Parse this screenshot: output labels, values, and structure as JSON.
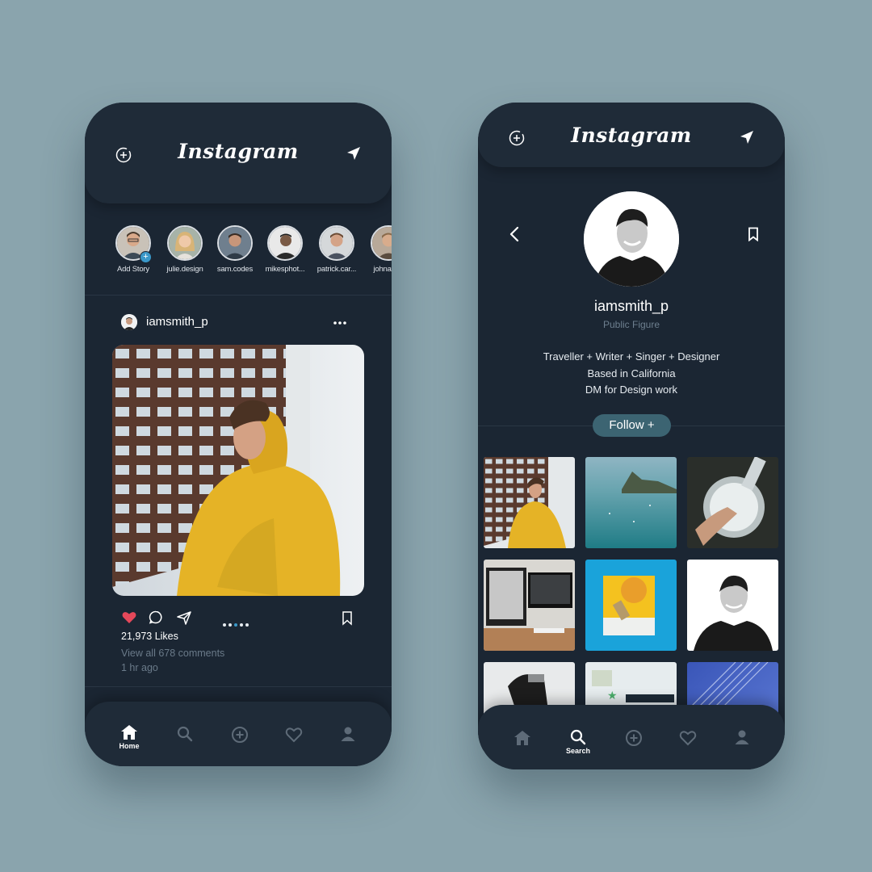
{
  "app": {
    "logo_text": "Instagram"
  },
  "feed": {
    "stories": [
      {
        "label": "Add Story"
      },
      {
        "label": "julie.design"
      },
      {
        "label": "sam.codes"
      },
      {
        "label": "mikesphot..."
      },
      {
        "label": "patrick.car..."
      },
      {
        "label": "johnath..."
      }
    ],
    "post": {
      "username": "iamsmith_p",
      "likes": "21,973 Likes",
      "comments": "View all 678 comments",
      "time": "1 hr ago",
      "carousel_active_index": 3,
      "carousel_count": 5
    }
  },
  "profile": {
    "username": "iamsmith_p",
    "role": "Public Figure",
    "bio": [
      "Traveller + Writer + Singer + Designer",
      "Based in California",
      "DM for Design work"
    ],
    "follow_label": "Follow +"
  },
  "nav_left": {
    "active": "Home",
    "home_label": "Home"
  },
  "nav_right": {
    "active": "Search",
    "search_label": "Search"
  },
  "colors": {
    "accent_blue": "#3a98c9",
    "like_red": "#e5485a",
    "bg": "#8aa4ad",
    "phone_bg": "#1b2633",
    "follow_bg": "#3c6472"
  },
  "icons": [
    "add-story-icon",
    "direct-message-icon",
    "more-icon",
    "heart-icon",
    "comment-icon",
    "share-icon",
    "bookmark-icon",
    "home-icon",
    "search-icon",
    "create-icon",
    "activity-icon",
    "profile-icon",
    "back-icon"
  ]
}
